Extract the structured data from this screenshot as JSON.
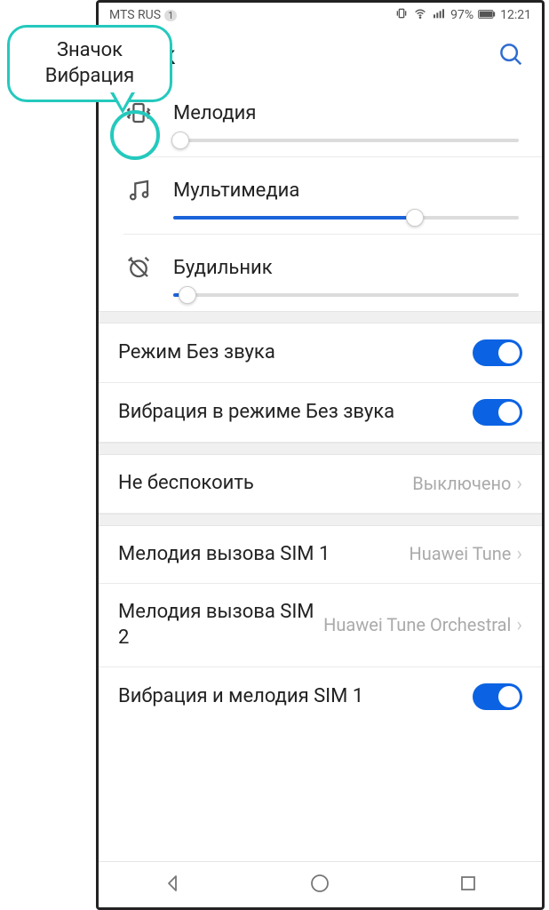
{
  "callout": {
    "line1": "Значок",
    "line2": "Вибрация"
  },
  "status": {
    "carrier": "MTS RUS",
    "carrier_badge": "1",
    "battery": "97%",
    "time": "12:21"
  },
  "header": {
    "title": "Звук"
  },
  "sliders": {
    "ringtone": {
      "label": "Мелодия",
      "value": 2
    },
    "media": {
      "label": "Мультимедиа",
      "value": 70
    },
    "alarm": {
      "label": "Будильник",
      "value": 4
    }
  },
  "toggles": {
    "silent": {
      "label": "Режим Без звука",
      "on": true
    },
    "vib_silent": {
      "label": "Вибрация в режиме Без звука",
      "on": true
    },
    "vib_ring_sim1": {
      "label": "Вибрация и мелодия SIM 1",
      "on": true
    }
  },
  "links": {
    "dnd": {
      "label": "Не беспокоить",
      "value": "Выключено"
    },
    "ring_sim1": {
      "label": "Мелодия вызова SIM 1",
      "value": "Huawei Tune"
    },
    "ring_sim2": {
      "label": "Мелодия вызова SIM 2",
      "value": "Huawei Tune Orchestral"
    }
  }
}
